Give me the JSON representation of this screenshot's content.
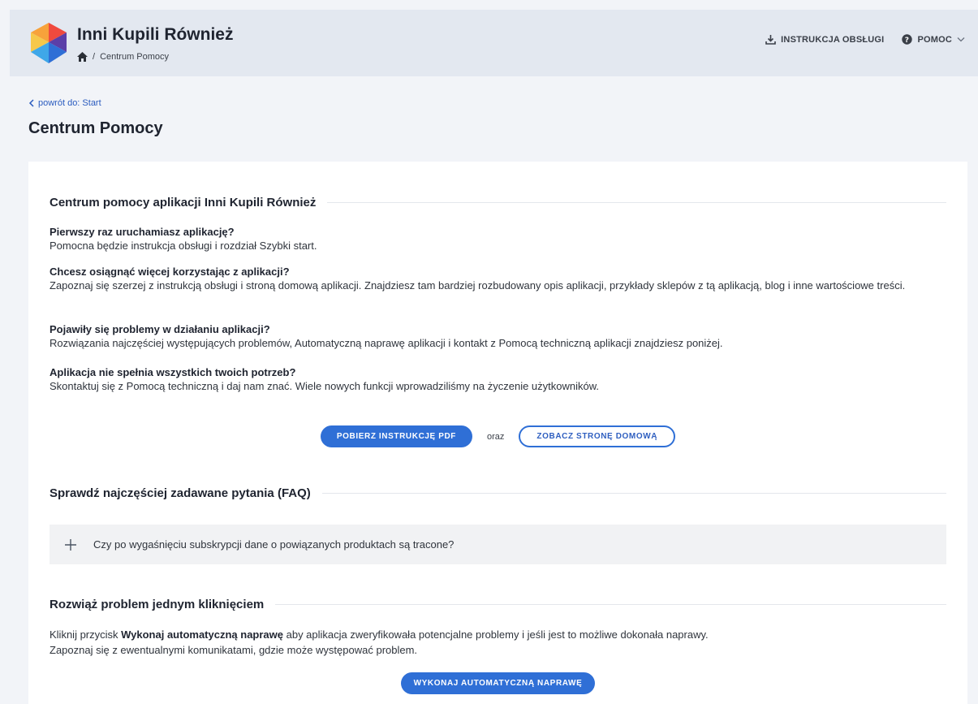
{
  "header": {
    "app_title": "Inni Kupili Również",
    "breadcrumb_sep": "/",
    "breadcrumb_current": "Centrum Pomocy",
    "nav_manual": "INSTRUKCJA OBSŁUGI",
    "nav_help": "POMOC"
  },
  "page": {
    "back_link": "powrót do: Start",
    "title": "Centrum Pomocy"
  },
  "help_section": {
    "heading": "Centrum pomocy aplikacji Inni Kupili Również",
    "items": [
      {
        "question": "Pierwszy raz uruchamiasz aplikację?",
        "answer": "Pomocna będzie instrukcja obsługi i rozdział Szybki start."
      },
      {
        "question": "Chcesz osiągnąć więcej korzystając z aplikacji?",
        "answer": "Zapoznaj się szerzej z instrukcją obsługi i stroną domową aplikacji. Znajdziesz tam bardziej rozbudowany opis aplikacji, przykłady sklepów z tą aplikacją, blog i inne wartościowe treści."
      },
      {
        "question": "Pojawiły się problemy w działaniu aplikacji?",
        "answer": "Rozwiązania najczęściej występujących problemów, Automatyczną naprawę aplikacji i kontakt z Pomocą techniczną aplikacji znajdziesz poniżej."
      },
      {
        "question": "Aplikacja nie spełnia wszystkich twoich potrzeb?",
        "answer": "Skontaktuj się z Pomocą techniczną i daj nam znać. Wiele nowych funkcji wprowadziliśmy na życzenie użytkowników."
      }
    ],
    "download_pdf_button": "POBIERZ INSTRUKCJĘ PDF",
    "or_text": "oraz",
    "homepage_button": "ZOBACZ STRONĘ DOMOWĄ"
  },
  "faq_section": {
    "heading": "Sprawdź najczęściej zadawane pytania (FAQ)",
    "items": [
      {
        "question": "Czy po wygaśnięciu subskrypcji dane o powiązanych produktach są tracone?"
      }
    ]
  },
  "fix_section": {
    "heading": "Rozwiąż problem jednym kliknięciem",
    "text_before": "Kliknij przycisk ",
    "text_bold": "Wykonaj automatyczną naprawę",
    "text_after": " aby aplikacja zweryfikowała potencjalne problemy i jeśli jest to możliwe dokonała naprawy.",
    "text_line2": "Zapoznaj się z ewentualnymi komunikatami, gdzie może występować problem.",
    "fix_button": "WYKONAJ AUTOMATYCZNĄ NAPRAWĘ"
  },
  "colors": {
    "accent": "#2f6fd6",
    "header_bg": "#e3e8f0",
    "page_bg": "#f2f4f8"
  }
}
